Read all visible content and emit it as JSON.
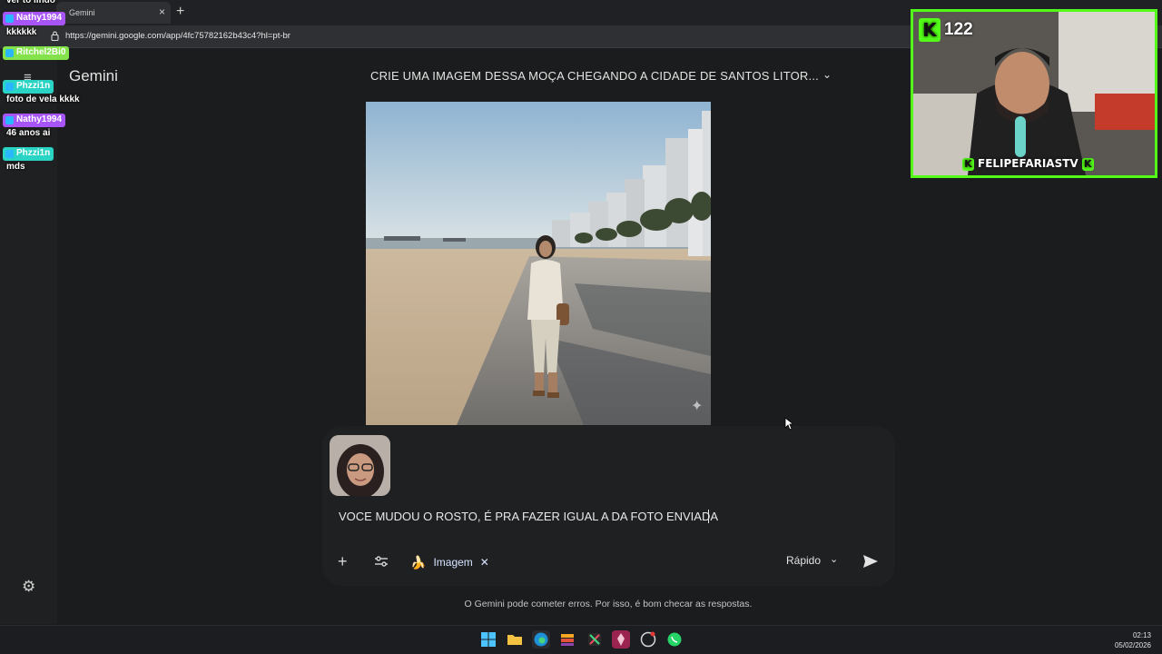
{
  "browser": {
    "tab_title": "Gemini",
    "tab_close": "×",
    "new_tab": "+",
    "url": "https://gemini.google.com/app/4fc75782162b43c4?hl=pt-br"
  },
  "chat": [
    {
      "type": "msg",
      "text": "ver to lindo"
    },
    {
      "type": "badge",
      "user": "Nathy1994",
      "color": "#a855f7"
    },
    {
      "type": "msg",
      "text": "kkkkkk"
    },
    {
      "type": "badge",
      "user": "Ritchel2Bi0",
      "color": "#84e34a"
    },
    {
      "type": "badge",
      "user": "Phzzi1n",
      "color": "#2ad4c4"
    },
    {
      "type": "msg",
      "text": "foto de vela kkkk"
    },
    {
      "type": "badge",
      "user": "Nathy1994",
      "color": "#a855f7"
    },
    {
      "type": "msg",
      "text": "46 anos ai"
    },
    {
      "type": "badge",
      "user": "Phzzi1n",
      "color": "#2ad4c4"
    },
    {
      "type": "msg",
      "text": "mds"
    }
  ],
  "sidebar": {
    "menu_icon": "≡",
    "settings_icon": "⚙"
  },
  "gemini": {
    "logo": "Gemini",
    "conversation_title": "CRIE UMA IMAGEM DESSA MOÇA CHEGANDO A CIDADE DE SANTOS LITOR...",
    "title_chevron": "⌄",
    "prompt": "VOCE MUDOU O ROSTO, É PRA FAZER IGUAL A DA FOTO ENVIADA",
    "add_icon": "+",
    "image_chip_label": "Imagem",
    "image_chip_icon": "🍌",
    "image_chip_remove": "✕",
    "model_label": "Rápido",
    "model_chevron": "⌄",
    "disclaimer": "O Gemini pode cometer erros. Por isso, é bom checar as respostas."
  },
  "stream": {
    "viewer_count": "122",
    "streamer_name": "FELIPEFARIASTV",
    "brand_color": "#53fc18"
  },
  "taskbar": {
    "time": "02:13",
    "date": "05/02/2026"
  }
}
